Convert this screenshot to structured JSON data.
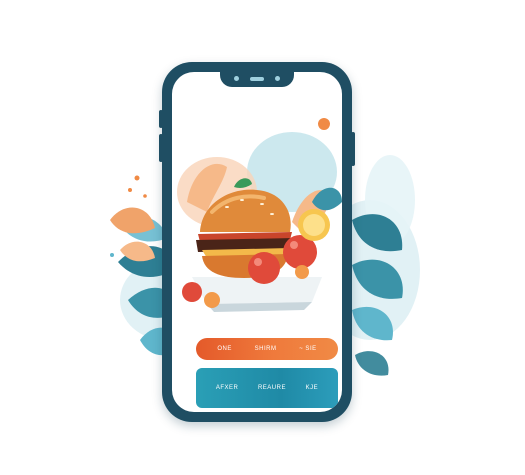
{
  "app": {
    "menu_row_top": [
      "ONE",
      "SHIRM",
      "~ SIE"
    ],
    "menu_row_bottom": [
      "AFXER",
      "REAURE",
      "KJE"
    ]
  },
  "colors": {
    "phone_frame": "#1f4e63",
    "accent_orange": "#e45a2a",
    "accent_teal": "#2a9fb6",
    "leaf_teal": "#5fb6cc",
    "leaf_orange": "#f0a36a"
  },
  "icons": {
    "hero": "burger-illustration-icon"
  }
}
